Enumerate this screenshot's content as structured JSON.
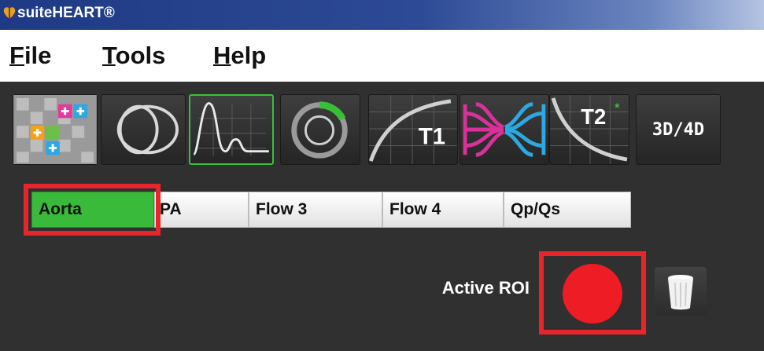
{
  "window": {
    "title": "suiteHEART®",
    "logo_icon": "suiteheart-logo-icon"
  },
  "menu": {
    "items": [
      {
        "mnemonic": "F",
        "rest": "ile"
      },
      {
        "mnemonic": "T",
        "rest": "ools"
      },
      {
        "mnemonic": "H",
        "rest": "elp"
      }
    ]
  },
  "toolbar": {
    "tools": [
      {
        "name": "function-analysis",
        "icon": "color-grid-icon"
      },
      {
        "name": "matrix",
        "icon": "ventricle-ring-icon"
      },
      {
        "name": "flow",
        "icon": "flow-curve-icon",
        "selected": true
      },
      {
        "name": "myocardial-evaluation",
        "icon": "target-ring-icon"
      },
      {
        "name": "t1-mapping",
        "icon": "t1-curve-icon",
        "label": "T1"
      },
      {
        "name": "virtual-fellow",
        "icon": "bullseye-tree-icon"
      },
      {
        "name": "t2-mapping",
        "icon": "t2-decay-icon",
        "label": "T2"
      },
      {
        "name": "3d-4d",
        "label": "3D/4D"
      }
    ]
  },
  "flow_tabs": {
    "items": [
      "Aorta",
      "PA",
      "Flow 3",
      "Flow 4",
      "Qp/Qs"
    ],
    "active": "Aorta"
  },
  "roi": {
    "label": "Active ROI",
    "color": "#ee1c24",
    "delete_icon": "trash-can-icon"
  },
  "colors": {
    "titlebar": "#1f3a84",
    "panel": "#303030",
    "active_tab": "#3aba3a",
    "selected_tool_border": "#39c039",
    "callout_box": "#e8252a"
  }
}
